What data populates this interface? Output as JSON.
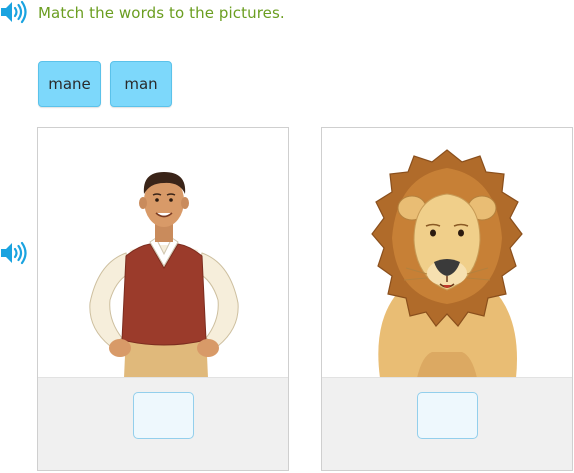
{
  "instruction": {
    "text": "Match the words to the pictures."
  },
  "word_tiles": [
    {
      "label": "mane"
    },
    {
      "label": "man"
    }
  ],
  "pictures": [
    {
      "icon": "man-illustration"
    },
    {
      "icon": "lion-illustration"
    }
  ],
  "colors": {
    "accent_text": "#6b9e21",
    "speaker": "#1aa3e0",
    "tile_bg": "#7dd8fb",
    "drop_zone_border": "#93cfec"
  }
}
